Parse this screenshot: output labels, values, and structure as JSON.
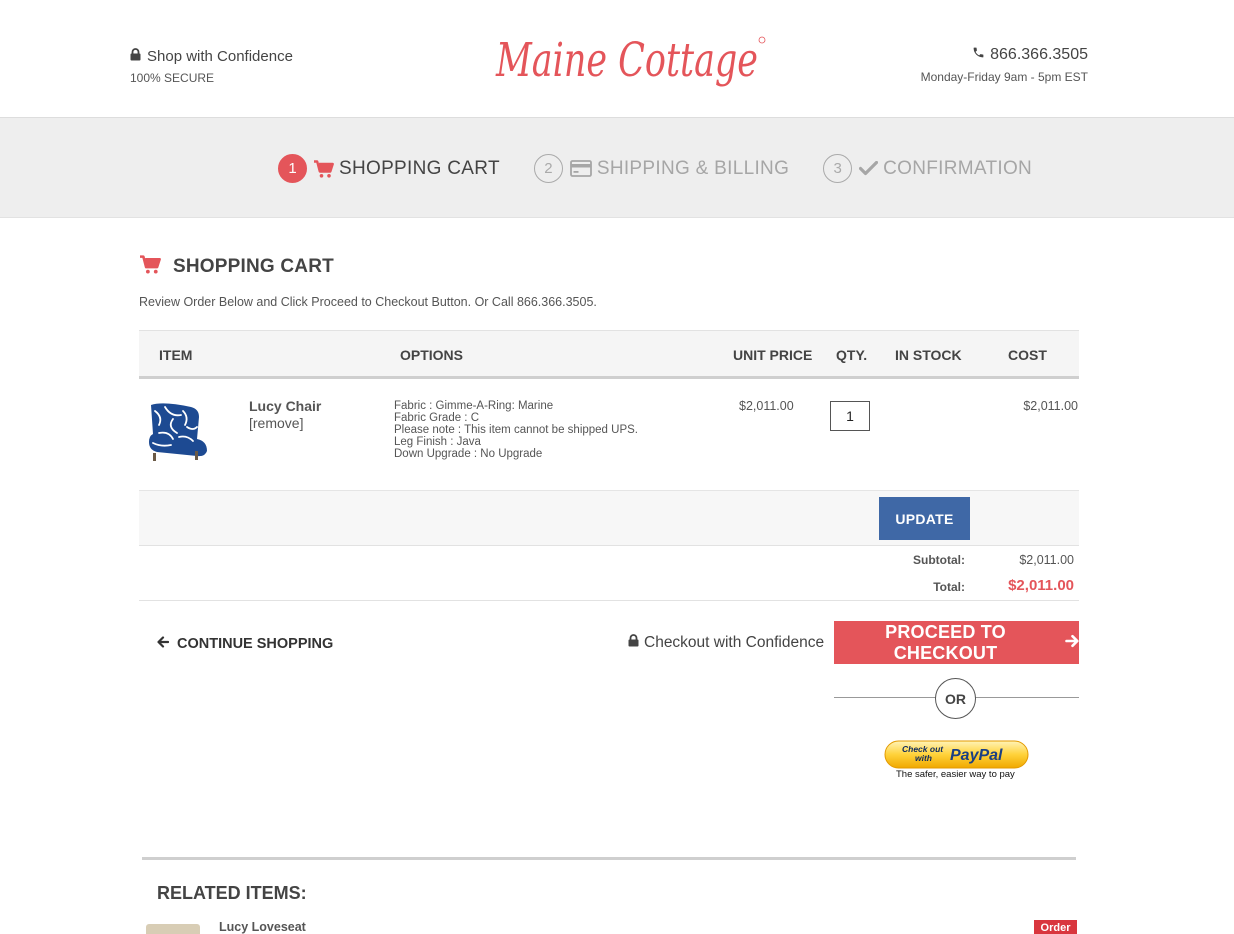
{
  "header": {
    "secure_title": "Shop with Confidence",
    "secure_sub": "100% SECURE",
    "logo_text": "Maine Cottage",
    "phone": "866.366.3505",
    "hours": "Monday-Friday 9am - 5pm EST"
  },
  "steps": [
    {
      "num": "1",
      "label": "SHOPPING CART",
      "icon": "cart-icon",
      "active": true
    },
    {
      "num": "2",
      "label": "SHIPPING & BILLING",
      "icon": "credit-card-icon",
      "active": false
    },
    {
      "num": "3",
      "label": "CONFIRMATION",
      "icon": "check-icon",
      "active": false
    }
  ],
  "cart": {
    "title": "SHOPPING CART",
    "instructions": "Review Order Below and Click Proceed to Checkout Button. Or Call 866.366.3505.",
    "columns": [
      "ITEM",
      "OPTIONS",
      "UNIT PRICE",
      "QTY.",
      "IN STOCK",
      "COST"
    ],
    "items": [
      {
        "name": "Lucy Chair",
        "remove_label": "[remove]",
        "options": [
          "Fabric : Gimme-A-Ring: Marine",
          "Fabric Grade : C",
          "Please note : This item cannot be shipped UPS.",
          "Leg Finish : Java",
          "Down Upgrade : No Upgrade"
        ],
        "unit_price": "$2,011.00",
        "qty": "1",
        "in_stock": "",
        "cost": "$2,011.00"
      }
    ],
    "update_label": "UPDATE",
    "subtotal_label": "Subtotal:",
    "subtotal": "$2,011.00",
    "total_label": "Total:",
    "total": "$2,011.00"
  },
  "actions": {
    "continue_label": "CONTINUE SHOPPING",
    "confidence_label": "Checkout with Confidence",
    "checkout_label": "PROCEED TO CHECKOUT",
    "or_label": "OR",
    "paypal_line1": "Check out",
    "paypal_line2": "with",
    "paypal_brand": "PayPal",
    "paypal_tagline": "The safer, easier way to pay"
  },
  "related": {
    "title": "RELATED ITEMS:",
    "items": [
      {
        "name": "Lucy Loveseat",
        "order_label": "Order"
      }
    ]
  },
  "colors": {
    "accent_red": "#e4555a",
    "update_blue": "#3f68a6",
    "steps_bg": "#eeeeee"
  }
}
